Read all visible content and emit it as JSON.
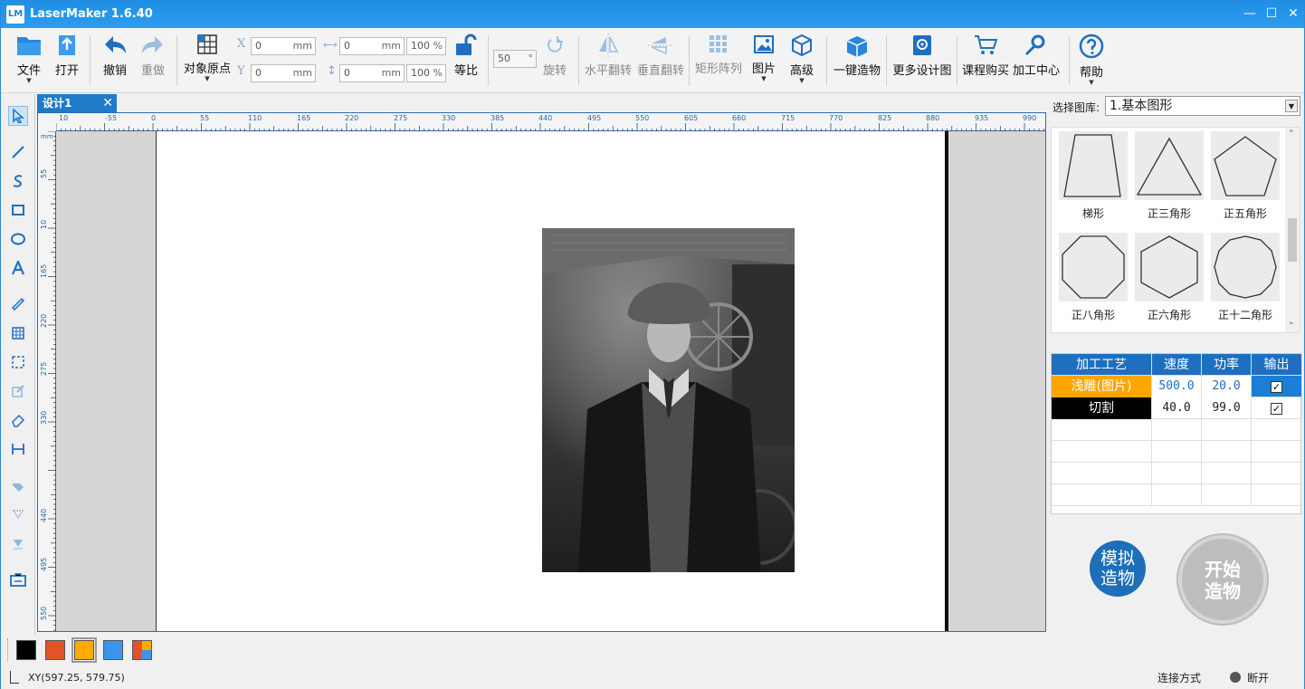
{
  "app": {
    "title": "LaserMaker 1.6.40",
    "logo_text": "LM"
  },
  "toolbar": {
    "file": "文件",
    "open": "打开",
    "undo": "撤销",
    "redo": "重做",
    "origin": "对象原点",
    "x_label": "X",
    "y_label": "Y",
    "x_value": "0",
    "y_value": "0",
    "unit": "mm",
    "w_value": "0",
    "h_value": "0",
    "w_pct": "100",
    "h_pct": "100",
    "pct_unit": "%",
    "proportional": "等比",
    "rotate_value": "50",
    "deg": "°",
    "rotate": "旋转",
    "hflip": "水平翻转",
    "vflip": "垂直翻转",
    "array": "矩形阵列",
    "image": "图片",
    "advanced": "高级",
    "oneclick": "一键造物",
    "more_designs": "更多设计图",
    "buy_course": "课程购买",
    "center": "加工中心",
    "help": "帮助"
  },
  "tab": {
    "label": "设计1",
    "close": "✕"
  },
  "ruler": {
    "h_ticks": [
      "10",
      "-55",
      "0",
      "55",
      "110",
      "165",
      "220",
      "275",
      "330",
      "385",
      "440",
      "495",
      "550",
      "605",
      "660",
      "715",
      "770",
      "825",
      "880",
      "935",
      "990"
    ],
    "v_ticks": [
      "55",
      "10",
      "165",
      "220",
      "275",
      "330",
      "440",
      "495",
      "550"
    ],
    "unit_label": "mm"
  },
  "library": {
    "label": "选择图库:",
    "selected": "1.基本图形",
    "shapes": [
      {
        "name": "梯形"
      },
      {
        "name": "正三角形"
      },
      {
        "name": "正五角形"
      },
      {
        "name": "正八角形"
      },
      {
        "name": "正六角形"
      },
      {
        "name": "正十二角形"
      }
    ]
  },
  "layers": {
    "headers": [
      "加工工艺",
      "速度",
      "功率",
      "输出"
    ],
    "rows": [
      {
        "process": "浅雕(图片)",
        "speed": "500.0",
        "power": "20.0",
        "output": "✓",
        "color": "#ffa500"
      },
      {
        "process": "切割",
        "speed": "40.0",
        "power": "99.0",
        "output": "✓",
        "color": "#000000"
      }
    ]
  },
  "actions": {
    "simulate": "模拟\n造物",
    "start": "开始\n造物"
  },
  "colors": [
    "#000000",
    "#e2532a",
    "#ffaa00",
    "#3d94e8",
    "multi"
  ],
  "status": {
    "coords": "XY(597.25, 579.75)",
    "connection_label": "连接方式",
    "connection_state": "断开"
  }
}
